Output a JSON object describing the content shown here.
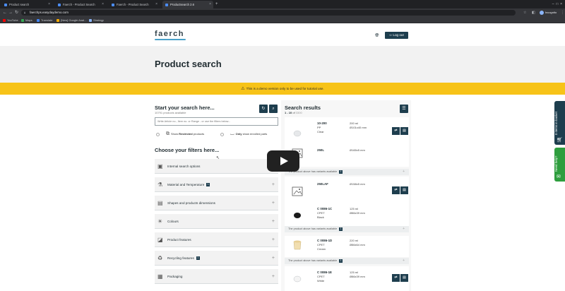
{
  "browser": {
    "tabs": [
      {
        "label": "Product search",
        "active": false
      },
      {
        "label": "Faerch - Product Search",
        "active": false
      },
      {
        "label": "Faerch - Product Search",
        "active": false
      },
      {
        "label": "Productsearch 2.6",
        "active": true
      }
    ],
    "new_tab": "+",
    "url": "faerchps.easydaydemo.com",
    "profile": "Incognito",
    "bookmarks": [
      {
        "label": "YouTube",
        "color": "#ff0000"
      },
      {
        "label": "Maps",
        "color": "#34a853"
      },
      {
        "label": "Translate",
        "color": "#4285f4"
      },
      {
        "label": "[New] Google Anal...",
        "color": "#f9ab00"
      },
      {
        "label": "Strategy",
        "color": "#8ab4f8"
      }
    ]
  },
  "header": {
    "logo": "faerch",
    "logout_label": "Log out"
  },
  "page": {
    "title": "Product search",
    "demo_banner": "This is a demo version only to be used for tutorial use."
  },
  "search": {
    "title": "Start your search here...",
    "subtitle": "10791 products available",
    "placeholder": "Write Article no., Item no. or Range - or use the filters below...",
    "opt_restricted_pre": "Show ",
    "opt_restricted_bold": "Restricted",
    "opt_restricted_post": " products",
    "opt_enrolled_bold": "Only",
    "opt_enrolled_post": " show enrolled parts"
  },
  "filters": {
    "title": "Choose your filters here...",
    "items": [
      {
        "label": "Internal search options",
        "badge": ""
      },
      {
        "label": "Material and Temperature",
        "badge": "1"
      },
      {
        "label": "Shapes and products dimensions",
        "badge": ""
      },
      {
        "label": "Colours",
        "badge": ""
      },
      {
        "label": "Product features",
        "badge": ""
      },
      {
        "label": "Recycling features",
        "badge": "1"
      },
      {
        "label": "Packaging",
        "badge": ""
      }
    ]
  },
  "results": {
    "title": "Search results",
    "range": "1 - 10",
    "of": "of",
    "total": "3300",
    "products": [
      {
        "name": "10-200",
        "material": "PP",
        "colour": "Clear",
        "volume": "200 ml",
        "dims": "Ø101x40 mm",
        "thumb": "cup-clear"
      },
      {
        "name": "250L",
        "material": "",
        "colour": "",
        "volume": "",
        "dims": "Ø165x5 mm",
        "thumb": "image-placeholder"
      },
      {
        "name": "250LAF",
        "material": "",
        "colour": "",
        "volume": "",
        "dims": "Ø158x5 mm",
        "thumb": "image-placeholder"
      },
      {
        "name": "C 0086-1C",
        "material": "CPET",
        "colour": "Black",
        "volume": "125 ml",
        "dims": "Ø86x39 mm",
        "thumb": "cup-black"
      },
      {
        "name": "C 0086-1D",
        "material": "CPET",
        "colour": "Cream",
        "volume": "220 ml",
        "dims": "Ø86x64 mm",
        "thumb": "cup-cream"
      },
      {
        "name": "C 0086-1E",
        "material": "CPET",
        "colour": "White",
        "volume": "125 ml",
        "dims": "Ø86x39 mm",
        "thumb": "cup-white"
      }
    ],
    "variants_text": "The product above has variants available",
    "variants_badge": "1"
  },
  "sidetabs": {
    "basket": "0 items in basket",
    "help": "Need help?"
  },
  "colors": {
    "accent": "#1e3e4e",
    "banner": "#f7c318",
    "basket_tab": "#1e3e4e",
    "help_tab": "#2e9e3e"
  }
}
